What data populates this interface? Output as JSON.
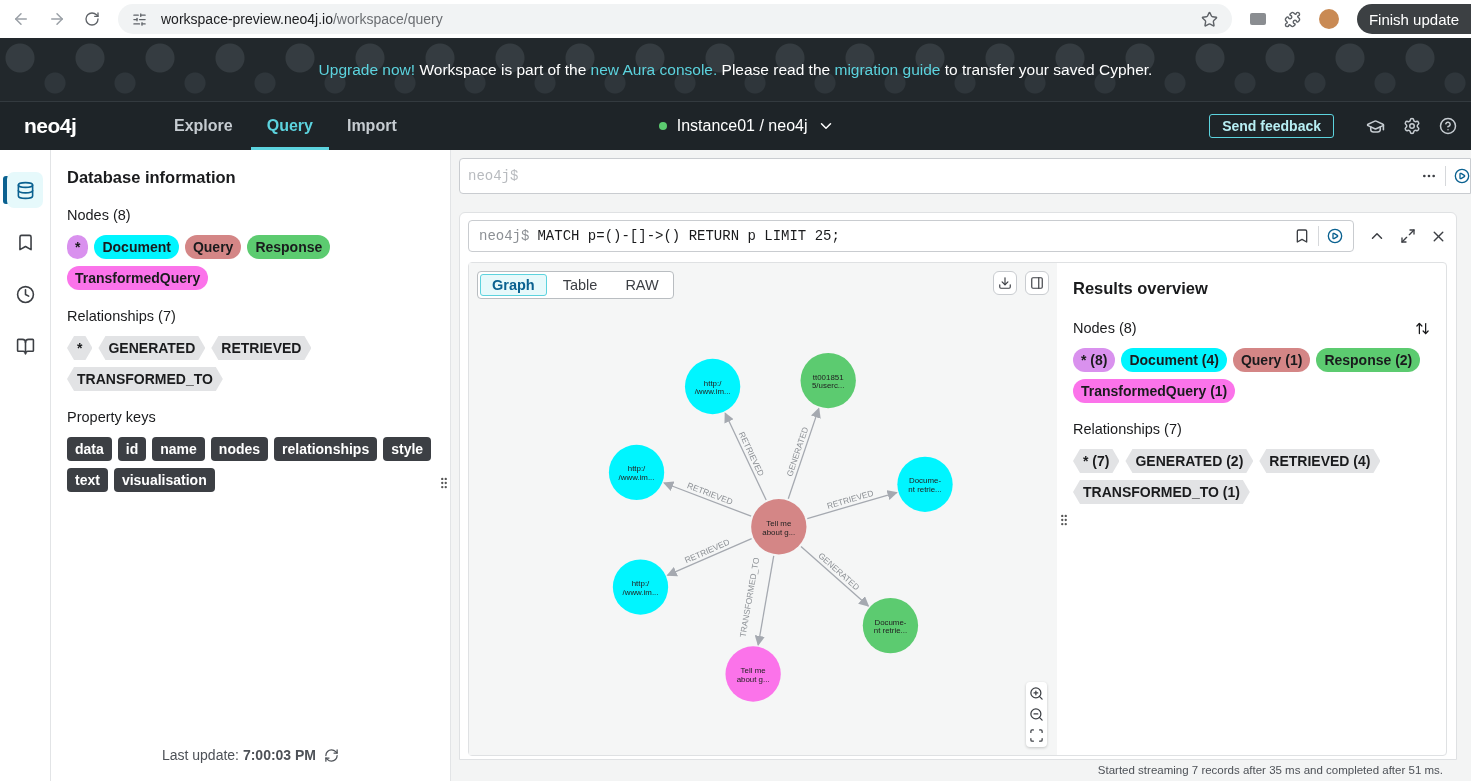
{
  "browser": {
    "url_host": "workspace-preview.neo4j.io",
    "url_path": "/workspace/query",
    "update_button": "Finish update"
  },
  "banner": {
    "segments": [
      {
        "kind": "link",
        "text": "Upgrade now!"
      },
      {
        "kind": "text",
        "text": " Workspace is part of the "
      },
      {
        "kind": "link",
        "text": "new Aura console."
      },
      {
        "kind": "text",
        "text": " Please read the "
      },
      {
        "kind": "link",
        "text": "migration guide"
      },
      {
        "kind": "text",
        "text": " to transfer your saved Cypher."
      }
    ]
  },
  "nav": {
    "logo": "neo4j",
    "tabs": [
      {
        "label": "Explore",
        "selected": false
      },
      {
        "label": "Query",
        "selected": true
      },
      {
        "label": "Import",
        "selected": false
      }
    ],
    "instance": {
      "name": "Instance01 / neo4j",
      "connected": true
    },
    "feedback": "Send feedback"
  },
  "rail": {
    "items": [
      {
        "selected": true
      },
      {
        "selected": false
      },
      {
        "selected": false
      },
      {
        "selected": false
      }
    ]
  },
  "sidebar": {
    "title": "Database information",
    "nodes_heading": "Nodes (8)",
    "node_labels": [
      {
        "label": "*",
        "color": "#d991ee"
      },
      {
        "label": "Document",
        "color": "#00f5ff"
      },
      {
        "label": "Query",
        "color": "#d48686"
      },
      {
        "label": "Response",
        "color": "#5ccb70"
      },
      {
        "label": "TransformedQuery",
        "color": "#fb73ea"
      }
    ],
    "relationships_heading": "Relationships (7)",
    "relationship_types": [
      "*",
      "GENERATED",
      "RETRIEVED",
      "TRANSFORMED_TO"
    ],
    "property_heading": "Property keys",
    "property_keys": [
      "data",
      "id",
      "name",
      "nodes",
      "relationships",
      "style",
      "text",
      "visualisation"
    ],
    "last_update_label": "Last update:",
    "last_update_time": "7:00:03 PM"
  },
  "editor": {
    "placeholder": "neo4j$"
  },
  "result": {
    "prompt": "neo4j$",
    "query": "MATCH p=()-[]->() RETURN p LIMIT 25;",
    "view_tabs": [
      {
        "label": "Graph",
        "selected": true
      },
      {
        "label": "Table",
        "selected": false
      },
      {
        "label": "RAW",
        "selected": false
      }
    ],
    "graph": {
      "nodes": [
        {
          "lines": [
            "Tell me",
            "about g..."
          ],
          "color": "#d48686"
        },
        {
          "lines": [
            "http:/",
            "/www.im..."
          ],
          "color": "#00f5ff"
        },
        {
          "lines": [
            "tt001851",
            "5/userc..."
          ],
          "color": "#5ccb70"
        },
        {
          "lines": [
            "http:/",
            "/www.im..."
          ],
          "color": "#00f5ff"
        },
        {
          "lines": [
            "Docume-",
            "nt retrie..."
          ],
          "color": "#00f5ff"
        },
        {
          "lines": [
            "http:/",
            "/www.im..."
          ],
          "color": "#00f5ff"
        },
        {
          "lines": [
            "Docume-",
            "nt retrie..."
          ],
          "color": "#5ccb70"
        },
        {
          "lines": [
            "Tell me",
            "about g..."
          ],
          "color": "#fb73ea"
        }
      ],
      "edges": [
        {
          "label": "RETRIEVED"
        },
        {
          "label": "GENERATED"
        },
        {
          "label": "RETRIEVED"
        },
        {
          "label": "RETRIEVED"
        },
        {
          "label": "RETRIEVED"
        },
        {
          "label": "GENERATED"
        },
        {
          "label": "TRANSFORMED_TO"
        }
      ]
    },
    "overview": {
      "title": "Results overview",
      "nodes_heading": "Nodes (8)",
      "node_chips": [
        {
          "label": "* (8)",
          "color": "#d991ee"
        },
        {
          "label": "Document (4)",
          "color": "#00f5ff"
        },
        {
          "label": "Query (1)",
          "color": "#d48686"
        },
        {
          "label": "Response (2)",
          "color": "#5ccb70"
        },
        {
          "label": "TransformedQuery (1)",
          "color": "#fb73ea"
        }
      ],
      "relationships_heading": "Relationships (7)",
      "relationship_chips": [
        "* (7)",
        "GENERATED (2)",
        "RETRIEVED (4)",
        "TRANSFORMED_TO (1)"
      ]
    },
    "status": "Started streaming 7 records after 35 ms and completed after 51 ms."
  }
}
